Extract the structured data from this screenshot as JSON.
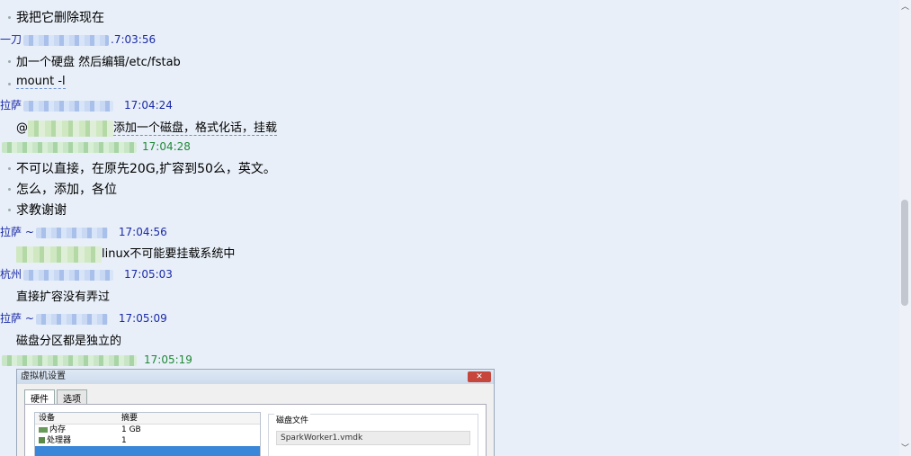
{
  "messages": [
    {
      "type": "text",
      "text": "我把它删除现在"
    },
    {
      "type": "sender",
      "time": ".7:03:56",
      "prefix": "一刀"
    },
    {
      "type": "text",
      "text": "加一个硬盘 然后编辑/etc/fstab"
    },
    {
      "type": "text",
      "text": "mount -l"
    },
    {
      "type": "sender",
      "time": "17:04:24",
      "prefix": "拉萨"
    },
    {
      "type": "mention",
      "at": "@",
      "text": "添加一个磁盘，格式化话，挂载"
    },
    {
      "type": "sender",
      "time": "17:04:28",
      "prefix": ""
    },
    {
      "type": "text",
      "text": "不可以直接，在原先20G,扩容到50么，英文。"
    },
    {
      "type": "text",
      "text": "怎么，添加，各位"
    },
    {
      "type": "text",
      "text": "求教谢谢"
    },
    {
      "type": "sender",
      "time": "17:04:56",
      "prefix": "拉萨 ~"
    },
    {
      "type": "mention",
      "text": "linux不可能要挂载系统中"
    },
    {
      "type": "sender",
      "time": "17:05:03",
      "prefix": "杭州"
    },
    {
      "type": "text",
      "text": "直接扩容没有弄过"
    },
    {
      "type": "sender",
      "time": "17:05:09",
      "prefix": "拉萨 ~"
    },
    {
      "type": "text",
      "text": "磁盘分区都是独立的"
    },
    {
      "type": "sender",
      "time": "17:05:19",
      "prefix": ""
    }
  ],
  "screenshot": {
    "title": "虚拟机设置",
    "tabs": [
      "硬件",
      "选项"
    ],
    "col_device": "设备",
    "col_summary": "摘要",
    "rows": [
      {
        "device": "内存",
        "summary": "1 GB"
      },
      {
        "device": "处理器",
        "summary": "1"
      }
    ],
    "disk_label": "磁盘文件",
    "disk_file": "SparkWorker1.vmdk"
  }
}
